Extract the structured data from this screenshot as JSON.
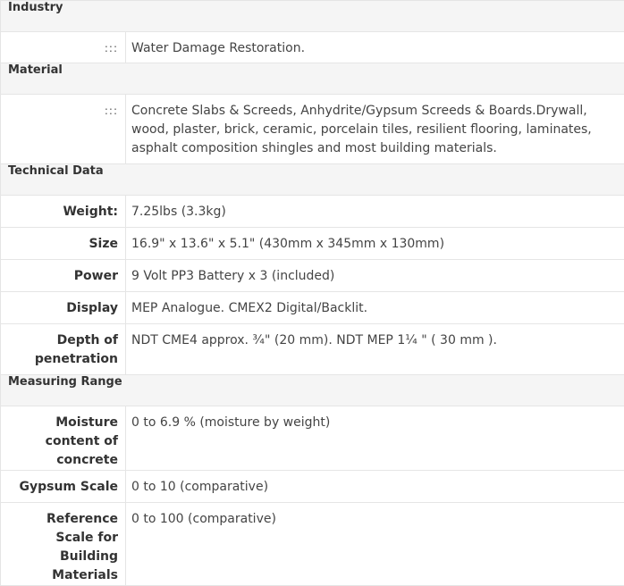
{
  "sections": {
    "industry": {
      "title": "Industry",
      "label": ":::",
      "value": "Water Damage Restoration."
    },
    "material": {
      "title": "Material",
      "label": ":::",
      "value": "Concrete Slabs & Screeds, Anhydrite/Gypsum Screeds & Boards.Drywall, wood, plaster, brick, ceramic, porcelain tiles, resilient flooring, laminates, asphalt composition shingles and most building materials."
    },
    "technical_data": {
      "title": "Technical Data",
      "rows": [
        {
          "label": "Weight:",
          "value": "7.25lbs (3.3kg)"
        },
        {
          "label": "Size",
          "value": "16.9\" x 13.6\" x 5.1\" (430mm x 345mm x 130mm)"
        },
        {
          "label": "Power",
          "value": "9 Volt PP3 Battery x 3 (included)"
        },
        {
          "label": "Display",
          "value": "MEP Analogue. CMEX2 Digital/Backlit."
        },
        {
          "label": "Depth of penetration",
          "value": "NDT CME4 approx. ¾\" (20 mm). NDT MEP 1¼ \" ( 30 mm )."
        }
      ]
    },
    "measuring_range": {
      "title": "Measuring Range",
      "rows": [
        {
          "label": "Moisture content of concrete",
          "value": "0 to 6.9 % (moisture by weight)"
        },
        {
          "label": "Gypsum Scale",
          "value": "0 to 10 (comparative)"
        },
        {
          "label": "Reference Scale for Building Materials",
          "value": "0 to 100 (comparative)"
        }
      ]
    }
  }
}
